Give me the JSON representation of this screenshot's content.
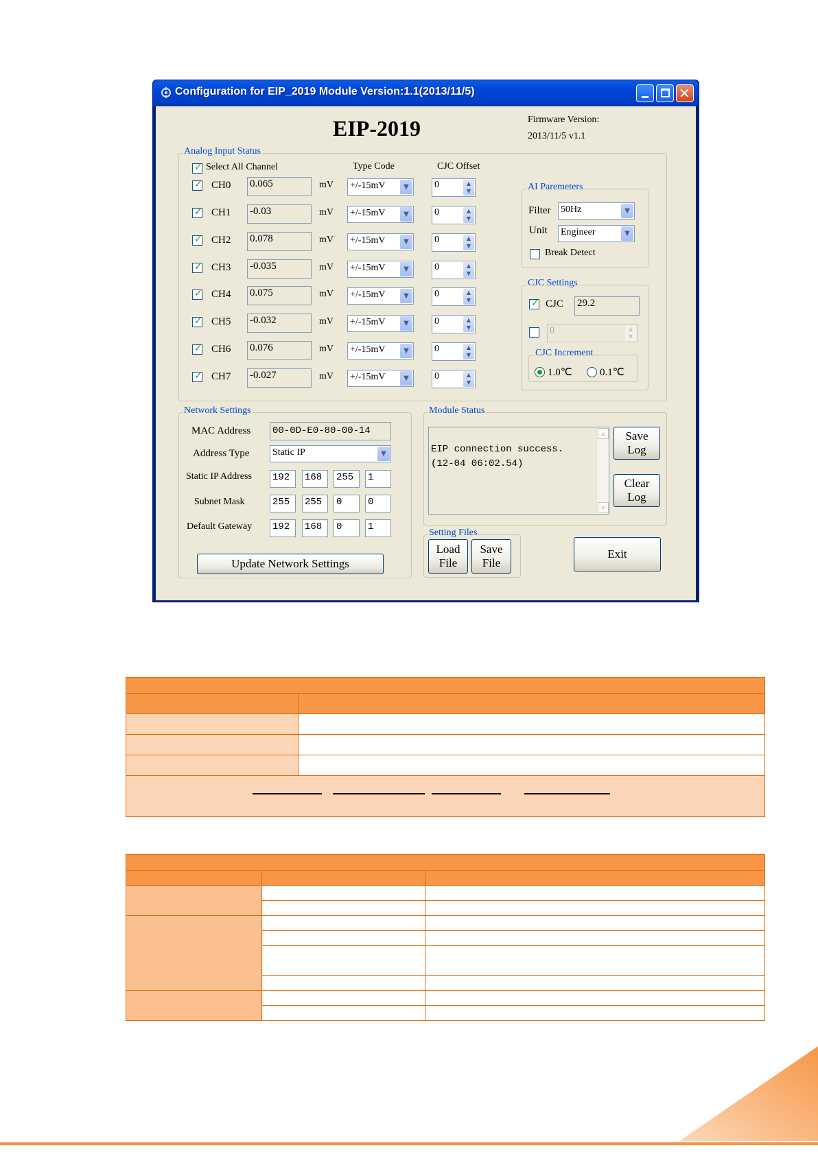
{
  "window": {
    "title": "Configuration for EIP_2019 Module Version:1.1(2013/11/5)",
    "controls": [
      "minimize",
      "maximize",
      "close"
    ]
  },
  "header": {
    "product": "EIP-2019",
    "firmware_label": "Firmware Version:",
    "firmware_value": "2013/11/5 v1.1"
  },
  "analog": {
    "group_title": "Analog Input Status",
    "select_all_label": "Select All Channel",
    "type_code_header": "Type Code",
    "cjc_offset_header": "CJC Offset",
    "unit": "mV",
    "channels": [
      {
        "name": "CH0",
        "value": "0.065",
        "type_code": "+/-15mV",
        "offset": "0"
      },
      {
        "name": "CH1",
        "value": "-0.03",
        "type_code": "+/-15mV",
        "offset": "0"
      },
      {
        "name": "CH2",
        "value": "0.078",
        "type_code": "+/-15mV",
        "offset": "0"
      },
      {
        "name": "CH3",
        "value": "-0.035",
        "type_code": "+/-15mV",
        "offset": "0"
      },
      {
        "name": "CH4",
        "value": "0.075",
        "type_code": "+/-15mV",
        "offset": "0"
      },
      {
        "name": "CH5",
        "value": "-0.032",
        "type_code": "+/-15mV",
        "offset": "0"
      },
      {
        "name": "CH6",
        "value": "0.076",
        "type_code": "+/-15mV",
        "offset": "0"
      },
      {
        "name": "CH7",
        "value": "-0.027",
        "type_code": "+/-15mV",
        "offset": "0"
      }
    ]
  },
  "ai_params": {
    "group_title": "AI Paremeters",
    "filter_label": "Filter",
    "filter_value": "50Hz",
    "unit_label": "Unit",
    "unit_value": "Engineer",
    "break_detect_label": "Break Detect"
  },
  "cjc": {
    "group_title": "CJC Settings",
    "cjc_label": "CJC",
    "cjc_value": "29.2",
    "offset_value": "0",
    "increment_title": "CJC Increment",
    "inc_1": "1.0℃",
    "inc_2": "0.1℃"
  },
  "network": {
    "group_title": "Network Settings",
    "mac_label": "MAC Address",
    "mac_value": "00-0D-E0-80-00-14",
    "addr_type_label": "Address Type",
    "addr_type_value": "Static IP",
    "ip_label": "Static IP Address",
    "ip": [
      "192",
      "168",
      "255",
      "1"
    ],
    "mask_label": "Subnet Mask",
    "mask": [
      "255",
      "255",
      "0",
      "0"
    ],
    "gw_label": "Default Gateway",
    "gw": [
      "192",
      "168",
      "0",
      "1"
    ],
    "update_button": "Update Network Settings"
  },
  "status": {
    "group_title": "Module Status",
    "log_line1": "EIP connection success.",
    "log_line2": "(12-04 06:02.54)",
    "save_log_1": "Save",
    "save_log_2": "Log",
    "clear_log_1": "Clear",
    "clear_log_2": "Log"
  },
  "files": {
    "group_title": "Setting Files",
    "load_1": "Load",
    "load_2": "File",
    "save_1": "Save",
    "save_2": "File",
    "exit": "Exit"
  },
  "colors": {
    "table_header": "#f79646",
    "table_light": "#fbd5b5",
    "table_medium": "#fac090",
    "table_border": "#e26b0a",
    "groupbox_title": "#0046d5"
  }
}
